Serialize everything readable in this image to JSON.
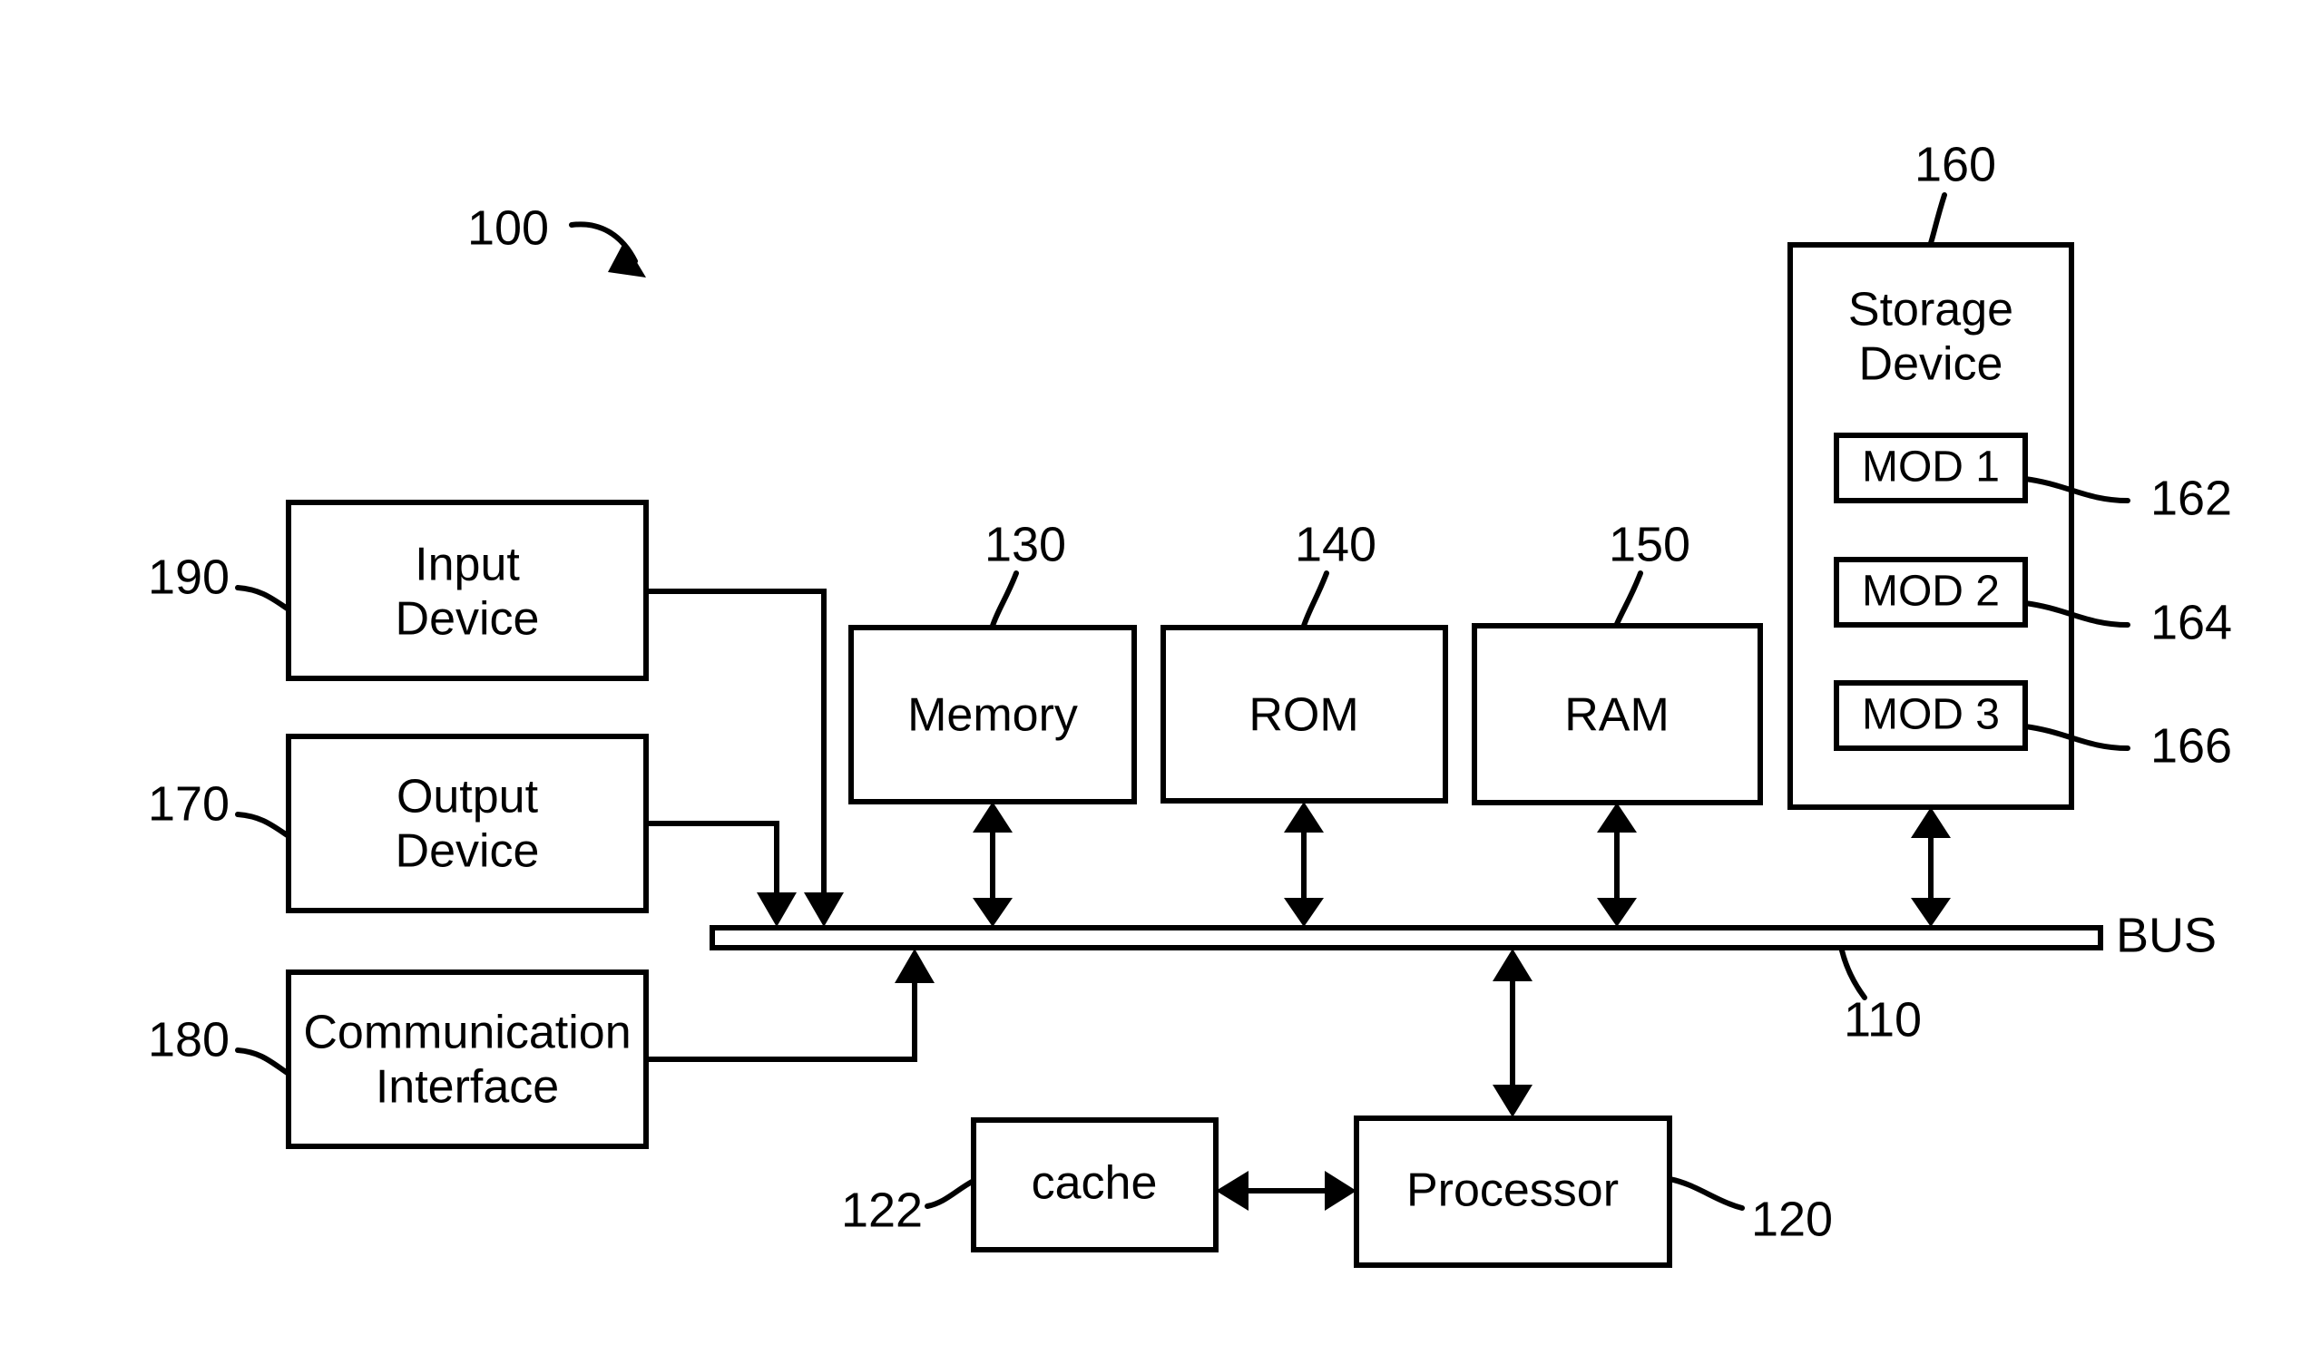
{
  "figure": {
    "type": "patent-block-diagram",
    "system_ref": "100",
    "background_color": "#ffffff",
    "line_color": "#000000"
  },
  "blocks": {
    "input_device": {
      "label_line1": "Input",
      "label_line2": "Device",
      "ref": "190"
    },
    "output_device": {
      "label_line1": "Output",
      "label_line2": "Device",
      "ref": "170"
    },
    "communication_interface": {
      "label_line1": "Communication",
      "label_line2": "Interface",
      "ref": "180"
    },
    "memory": {
      "label": "Memory",
      "ref": "130"
    },
    "rom": {
      "label": "ROM",
      "ref": "140"
    },
    "ram": {
      "label": "RAM",
      "ref": "150"
    },
    "storage_device": {
      "label_line1": "Storage",
      "label_line2": "Device",
      "ref": "160",
      "modules": [
        {
          "label": "MOD 1",
          "ref": "162"
        },
        {
          "label": "MOD 2",
          "ref": "164"
        },
        {
          "label": "MOD 3",
          "ref": "166"
        }
      ]
    },
    "cache": {
      "label": "cache",
      "ref": "122"
    },
    "processor": {
      "label": "Processor",
      "ref": "120"
    },
    "bus": {
      "label": "BUS",
      "ref": "110"
    }
  }
}
